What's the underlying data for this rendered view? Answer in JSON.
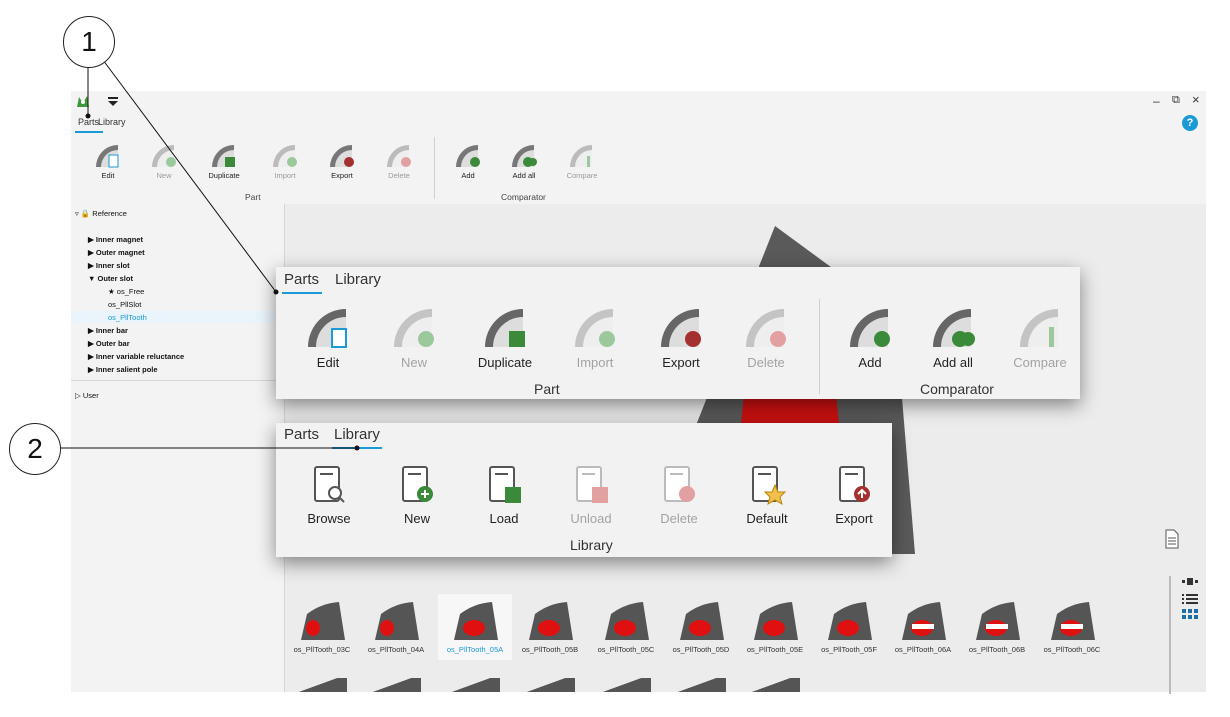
{
  "callouts": {
    "one": "1",
    "two": "2"
  },
  "window": {
    "minimize": "–",
    "restore": "⧉",
    "close": "×",
    "help": "?"
  },
  "small_ribbon": {
    "tabs": [
      "Parts",
      "Library"
    ],
    "buttons": [
      {
        "label": "Edit",
        "icon": "edit-icon",
        "enabled": true
      },
      {
        "label": "New",
        "icon": "new-icon",
        "enabled": false
      },
      {
        "label": "Duplicate",
        "icon": "duplicate-icon",
        "enabled": true
      },
      {
        "label": "Import",
        "icon": "import-icon",
        "enabled": false
      },
      {
        "label": "Export",
        "icon": "export-icon",
        "enabled": true
      },
      {
        "label": "Delete",
        "icon": "delete-icon",
        "enabled": false
      },
      {
        "label": "Add",
        "icon": "add-icon",
        "enabled": true
      },
      {
        "label": "Add all",
        "icon": "add-all-icon",
        "enabled": true
      },
      {
        "label": "Compare",
        "icon": "compare-icon",
        "enabled": false
      }
    ],
    "groups": [
      "Part",
      "Comparator"
    ]
  },
  "sidebar": {
    "reference_label": "Reference",
    "items": [
      {
        "label": "Inner magnet",
        "type": "collapsed"
      },
      {
        "label": "Outer magnet",
        "type": "collapsed"
      },
      {
        "label": "Inner slot",
        "type": "collapsed"
      },
      {
        "label": "Outer slot",
        "type": "expanded"
      },
      {
        "label": "★ os_Free",
        "type": "child"
      },
      {
        "label": "os_PllSlot",
        "type": "child"
      },
      {
        "label": "os_PllTooth",
        "type": "child-selected"
      },
      {
        "label": "Inner bar",
        "type": "collapsed"
      },
      {
        "label": "Outer bar",
        "type": "collapsed"
      },
      {
        "label": "Inner variable reluctance",
        "type": "collapsed"
      },
      {
        "label": "Inner salient pole",
        "type": "collapsed"
      }
    ],
    "user_label": "User"
  },
  "overlay_parts": {
    "tabs": [
      "Parts",
      "Library"
    ],
    "buttons": [
      {
        "label": "Edit",
        "enabled": true
      },
      {
        "label": "New",
        "enabled": false
      },
      {
        "label": "Duplicate",
        "enabled": true
      },
      {
        "label": "Import",
        "enabled": false
      },
      {
        "label": "Export",
        "enabled": true
      },
      {
        "label": "Delete",
        "enabled": false
      },
      {
        "label": "Add",
        "enabled": true
      },
      {
        "label": "Add all",
        "enabled": true
      },
      {
        "label": "Compare",
        "enabled": false
      }
    ],
    "groups": [
      "Part",
      "Comparator"
    ]
  },
  "overlay_library": {
    "tabs": [
      "Parts",
      "Library"
    ],
    "buttons": [
      {
        "label": "Browse",
        "enabled": true
      },
      {
        "label": "New",
        "enabled": true
      },
      {
        "label": "Load",
        "enabled": true
      },
      {
        "label": "Unload",
        "enabled": false
      },
      {
        "label": "Delete",
        "enabled": false
      },
      {
        "label": "Default",
        "enabled": true
      },
      {
        "label": "Export",
        "enabled": true
      }
    ],
    "group": "Library"
  },
  "thumbnails": [
    "os_PllTooth_03C",
    "os_PllTooth_04A",
    "os_PllTooth_05A",
    "os_PllTooth_05B",
    "os_PllTooth_05C",
    "os_PllTooth_05D",
    "os_PllTooth_05E",
    "os_PllTooth_05F",
    "os_PllTooth_06A",
    "os_PllTooth_06B",
    "os_PllTooth_06C"
  ],
  "colors": {
    "accent": "#1a9ad6",
    "tooth_grey": "#555555",
    "tooth_red": "#e01010"
  }
}
